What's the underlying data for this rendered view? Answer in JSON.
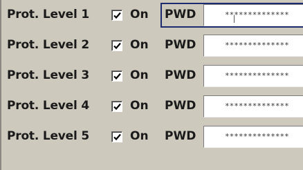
{
  "rows": [
    {
      "label": "Prot. Level 1",
      "on_label": "On",
      "pwd_label": "PWD",
      "password": "**************",
      "checked": true,
      "focused": true
    },
    {
      "label": "Prot. Level 2",
      "on_label": "On",
      "pwd_label": "PWD",
      "password": "**************",
      "checked": true,
      "focused": false
    },
    {
      "label": "Prot. Level 3",
      "on_label": "On",
      "pwd_label": "PWD",
      "password": "**************",
      "checked": true,
      "focused": false
    },
    {
      "label": "Prot. Level 4",
      "on_label": "On",
      "pwd_label": "PWD",
      "password": "**************",
      "checked": true,
      "focused": false
    },
    {
      "label": "Prot. Level 5",
      "on_label": "On",
      "pwd_label": "PWD",
      "password": "**************",
      "checked": true,
      "focused": false
    }
  ],
  "colors": {
    "focus_border": "#1c2a6e",
    "panel_bg": "#cdc9bd"
  },
  "icons": {
    "checkbox": "check-mark-icon"
  }
}
